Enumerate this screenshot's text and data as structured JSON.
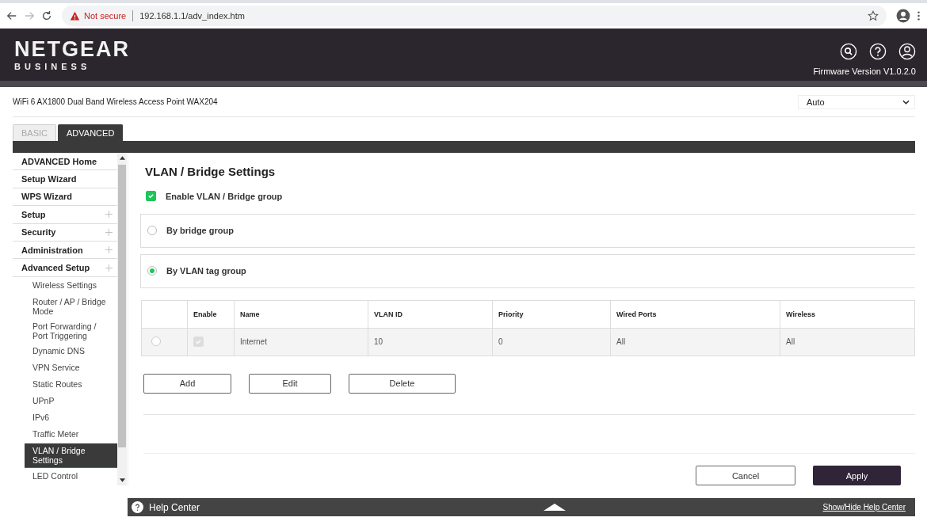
{
  "browser": {
    "security": "Not secure",
    "url": "192.168.1.1/adv_index.htm"
  },
  "header": {
    "logo": "NETGEAR",
    "logo_sub": "BUSINESS",
    "firmware": "Firmware Version V1.0.2.0"
  },
  "model": "WiFi 6 AX1800 Dual Band Wireless Access Point WAX204",
  "language_select": {
    "value": "Auto"
  },
  "tabs": [
    {
      "label": "BASIC",
      "selected": false
    },
    {
      "label": "ADVANCED",
      "selected": true
    }
  ],
  "sidebar": {
    "items": [
      {
        "label": "ADVANCED Home",
        "expandable": false
      },
      {
        "label": "Setup Wizard",
        "expandable": false
      },
      {
        "label": "WPS Wizard",
        "expandable": false
      },
      {
        "label": "Setup",
        "expandable": true
      },
      {
        "label": "Security",
        "expandable": true
      },
      {
        "label": "Administration",
        "expandable": true
      },
      {
        "label": "Advanced Setup",
        "expandable": true,
        "children": [
          {
            "label": "Wireless Settings",
            "selected": false
          },
          {
            "label": "Router / AP / Bridge Mode",
            "selected": false
          },
          {
            "label": "Port Forwarding / Port Triggering",
            "selected": false
          },
          {
            "label": "Dynamic DNS",
            "selected": false
          },
          {
            "label": "VPN Service",
            "selected": false
          },
          {
            "label": "Static Routes",
            "selected": false
          },
          {
            "label": "UPnP",
            "selected": false
          },
          {
            "label": "IPv6",
            "selected": false
          },
          {
            "label": "Traffic Meter",
            "selected": false
          },
          {
            "label": "VLAN / Bridge Settings",
            "selected": true
          },
          {
            "label": "LED Control",
            "selected": false
          }
        ]
      }
    ]
  },
  "content": {
    "title": "VLAN / Bridge Settings",
    "enable": {
      "label": "Enable VLAN / Bridge group",
      "checked": true
    },
    "modes": [
      {
        "label": "By bridge group",
        "selected": false
      },
      {
        "label": "By VLAN tag group",
        "selected": true
      }
    ],
    "table": {
      "headers": {
        "enable": "Enable",
        "name": "Name",
        "vlan_id": "VLAN ID",
        "priority": "Priority",
        "wired_ports": "Wired Ports",
        "wireless": "Wireless"
      },
      "rows": [
        {
          "selected": false,
          "enabled": true,
          "disabled": true,
          "name": "Internet",
          "vlan_id": "10",
          "priority": "0",
          "wired_ports": "All",
          "wireless": "All"
        }
      ]
    },
    "table_buttons": [
      "Add",
      "Edit",
      "Delete"
    ],
    "cancel": "Cancel",
    "apply": "Apply"
  },
  "help_bar": {
    "label": "Help Center",
    "toggle": "Show/Hide Help Center"
  }
}
